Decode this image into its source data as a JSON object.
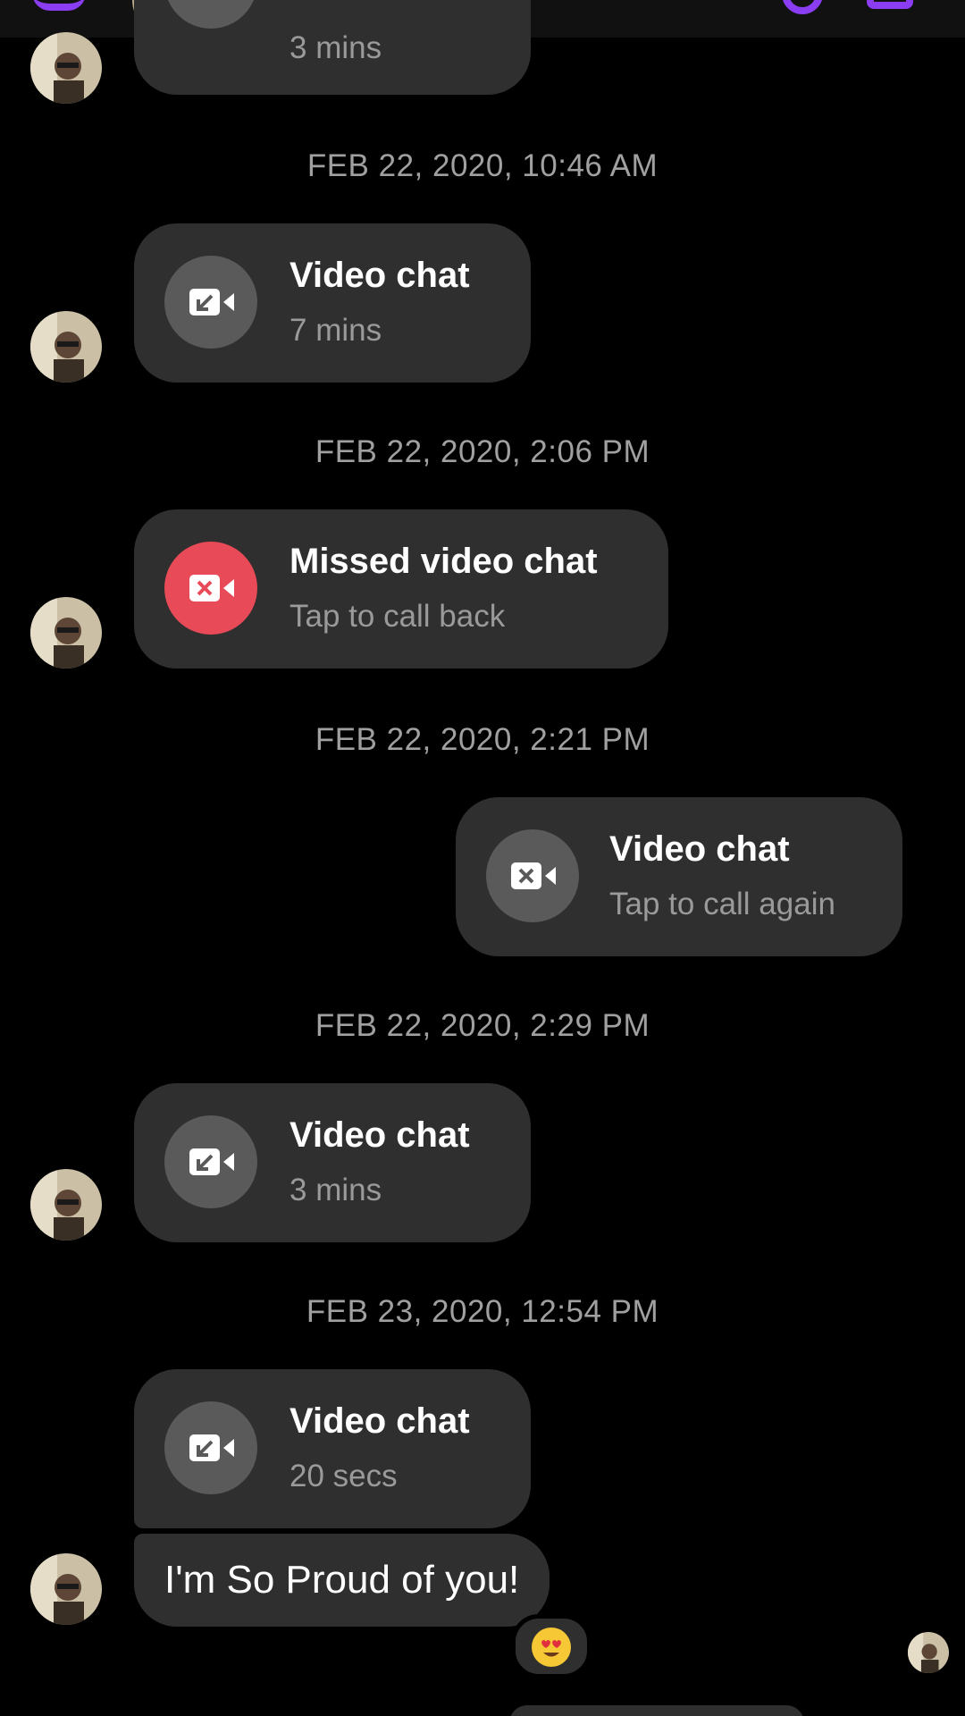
{
  "colors": {
    "background": "#000000",
    "bubble": "#2f2f2f",
    "call_icon_bg": "#5a5a5a",
    "missed_icon_bg": "#e84a57",
    "accent": "#8b3df2",
    "timestamp_text": "#a0a0a0",
    "subtitle_text": "#9a9a9a"
  },
  "header": {
    "icons": [
      "back-arrow-icon",
      "audio-call-icon",
      "video-call-icon"
    ]
  },
  "messages": {
    "top_partial": {
      "subtitle": "3 mins",
      "icon": "video-camera-incoming-icon"
    },
    "ts1": "FEB 22, 2020, 10:46 AM",
    "call1": {
      "title": "Video chat",
      "subtitle": "7 mins",
      "icon": "video-camera-incoming-icon"
    },
    "ts2": "FEB 22, 2020, 2:06 PM",
    "call2": {
      "title": "Missed video chat",
      "subtitle": "Tap to call back",
      "icon": "video-camera-missed-icon"
    },
    "ts3": "FEB 22, 2020, 2:21 PM",
    "call3": {
      "title": "Video chat",
      "subtitle": "Tap to call again",
      "icon": "video-camera-missed-icon"
    },
    "ts4": "FEB 22, 2020, 2:29 PM",
    "call4": {
      "title": "Video chat",
      "subtitle": "3 mins",
      "icon": "video-camera-incoming-icon"
    },
    "ts5": "FEB 23, 2020, 12:54 PM",
    "call5": {
      "title": "Video chat",
      "subtitle": "20 secs",
      "icon": "video-camera-incoming-icon"
    },
    "text1": {
      "text": "I'm So Proud of you!",
      "reaction": "heart-eyes-emoji"
    }
  }
}
